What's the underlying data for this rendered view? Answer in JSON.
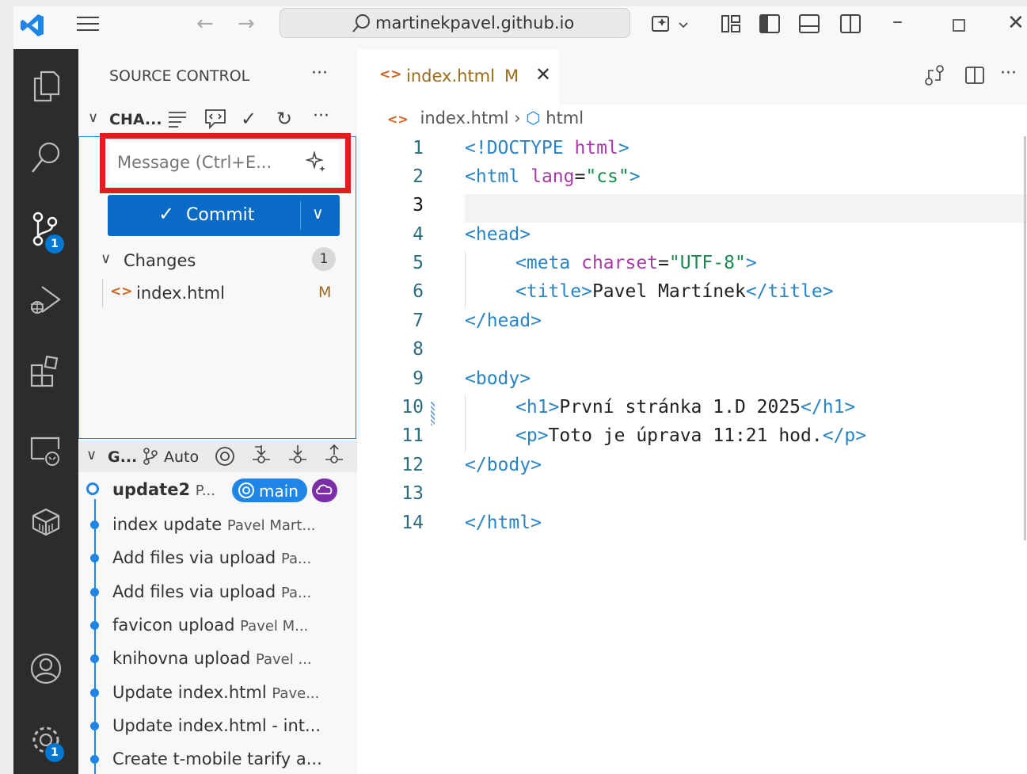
{
  "titlebar": {
    "search_text": "martinekpavel.github.io"
  },
  "activity": {
    "scm_badge": "1",
    "settings_badge": "1"
  },
  "sidebar": {
    "title": "SOURCE CONTROL",
    "changes_header": "CHA...",
    "message_placeholder": "Message (Ctrl+E...",
    "commit_label": "Commit",
    "changes_label": "Changes",
    "changes_count": "1",
    "file_name": "index.html",
    "file_status": "M",
    "graph_header": "G...",
    "graph_auto": "Auto",
    "commits": [
      {
        "title": "update2",
        "author": "P..."
      },
      {
        "title": "index update",
        "author": "Pavel Mart..."
      },
      {
        "title": "Add files via upload",
        "author": "Pa..."
      },
      {
        "title": "Add files via upload",
        "author": "Pa..."
      },
      {
        "title": "favicon upload",
        "author": "Pavel M..."
      },
      {
        "title": "knihovna upload",
        "author": "Pavel ..."
      },
      {
        "title": "Update index.html",
        "author": "Pave..."
      },
      {
        "title": "Update index.html - int...",
        "author": ""
      },
      {
        "title": "Create t-mobile tarify a...",
        "author": ""
      }
    ],
    "branch_label": "main"
  },
  "editor": {
    "tab_name": "index.html",
    "tab_status": "M",
    "breadcrumb_file": "index.html",
    "breadcrumb_symbol": "html",
    "lines": [
      [
        "1",
        "<!DOCTYPE ",
        "html",
        ">"
      ],
      [
        "2"
      ],
      [
        "3"
      ],
      [
        "4"
      ],
      [
        "5"
      ],
      [
        "6"
      ],
      [
        "7"
      ],
      [
        "8"
      ],
      [
        "9"
      ],
      [
        "10"
      ],
      [
        "11"
      ],
      [
        "12"
      ],
      [
        "13"
      ],
      [
        "14"
      ]
    ]
  },
  "code": {
    "l1a": "<!DOCTYPE ",
    "l1b": "html",
    "l1c": ">",
    "l2a": "<html ",
    "l2b": "lang",
    "l2c": "=",
    "l2d": "\"cs\"",
    "l2e": ">",
    "l4": "<head>",
    "l5a": "<meta ",
    "l5b": "charset",
    "l5c": "=",
    "l5d": "\"UTF-8\"",
    "l5e": ">",
    "l6a": "<title>",
    "l6b": "Pavel Martínek",
    "l6c": "</title>",
    "l7": "</head>",
    "l9": "<body>",
    "l10a": "<h1>",
    "l10b": "První stránka 1.D 2025",
    "l10c": "</h1>",
    "l11a": "<p>",
    "l11b": "Toto je úprava 11:21 hod.",
    "l11c": "</p>",
    "l12": "</body>",
    "l14": "</html>"
  }
}
